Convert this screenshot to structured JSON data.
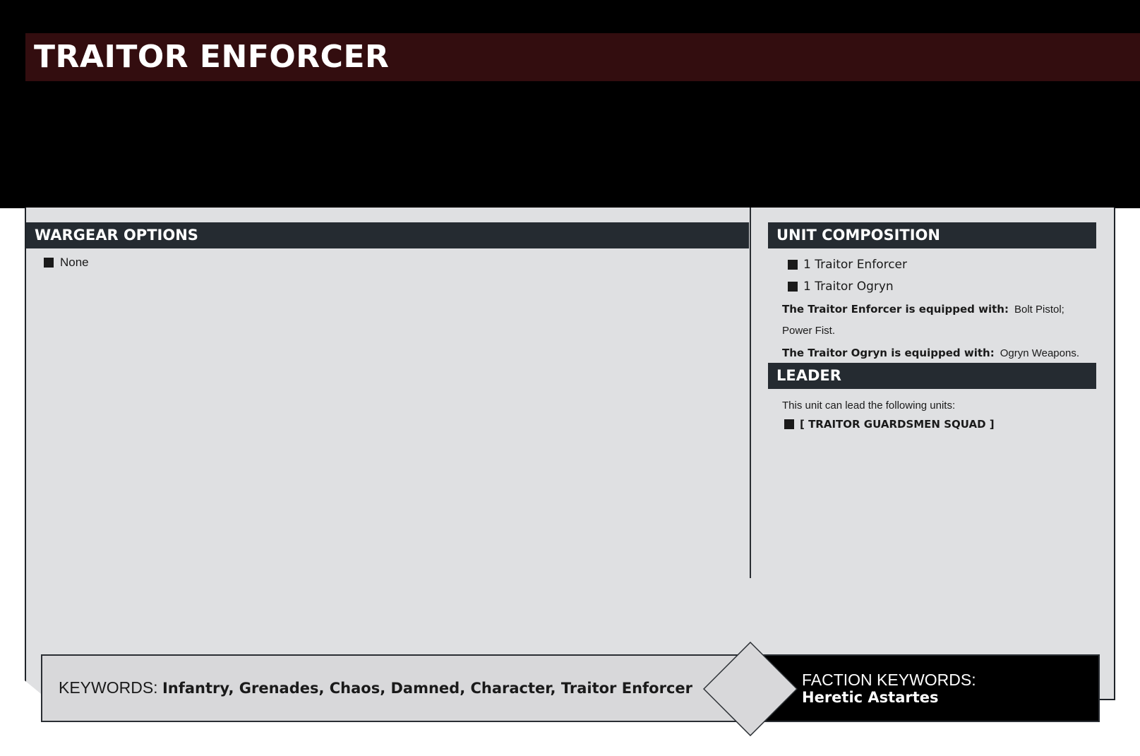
{
  "unit": {
    "name": "TRAITOR ENFORCER"
  },
  "wargear": {
    "header": "WARGEAR OPTIONS",
    "items": [
      "None"
    ]
  },
  "composition": {
    "header": "UNIT COMPOSITION",
    "items": [
      "1 Traitor Enforcer",
      "1 Traitor Ogryn"
    ],
    "equipment": [
      {
        "label": "The Traitor Enforcer is equipped with:",
        "value": "Bolt Pistol; Power Fist."
      },
      {
        "label": "The Traitor Ogryn is equipped with:",
        "value": "Ogryn Weapons."
      }
    ]
  },
  "leader": {
    "header": "LEADER",
    "text": "This unit can lead the following units:",
    "units": [
      "[ TRAITOR GUARDSMEN SQUAD ]"
    ]
  },
  "keywords": {
    "label": "KEYWORDS:",
    "values": "Infantry, Grenades, Chaos, Damned, Character, Traitor Enforcer"
  },
  "faction": {
    "label": "FACTION KEYWORDS:",
    "value": "Heretic Astartes"
  },
  "colors": {
    "title_bar": "#330d0f",
    "section_header": "#252b31",
    "card_body": "#dfe0e2"
  }
}
